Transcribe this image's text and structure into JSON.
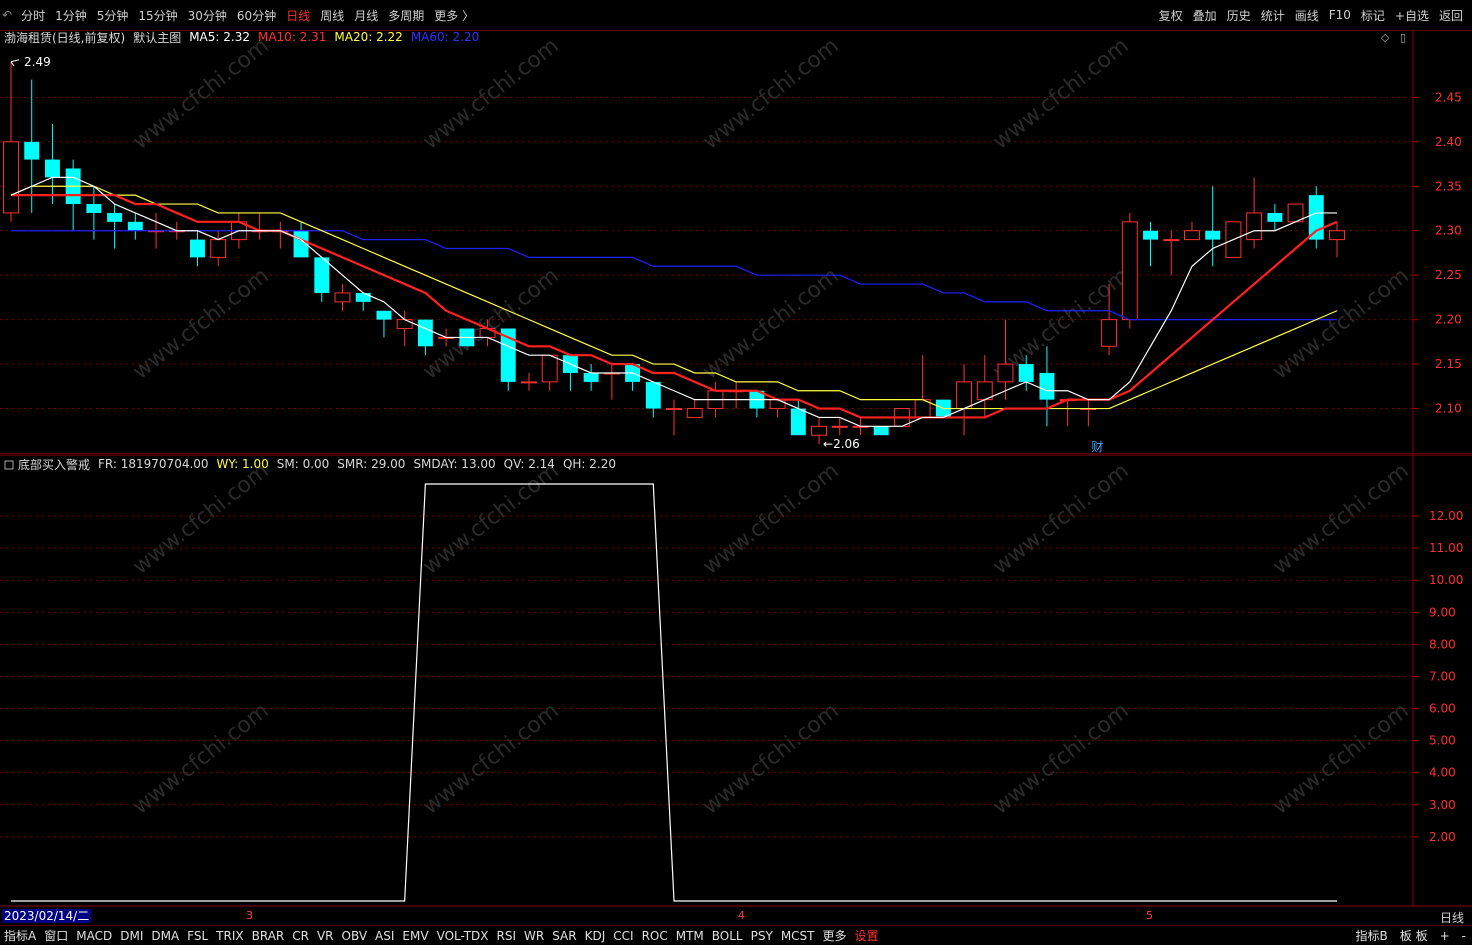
{
  "toolbar": {
    "periods": [
      "分时",
      "1分钟",
      "5分钟",
      "15分钟",
      "30分钟",
      "60分钟",
      "日线",
      "周线",
      "月线",
      "多周期",
      "更多 〉"
    ],
    "active_period": "日线",
    "right_buttons": [
      "复权",
      "叠加",
      "历史",
      "统计",
      "画线",
      "F10",
      "标记",
      "+自选",
      "返回"
    ]
  },
  "main_chart": {
    "stock_title": "渤海租赁(日线,前复权)",
    "template_label": "默认主图",
    "ma5": {
      "label": "MA5: 2.32",
      "color": "#ffffff"
    },
    "ma10": {
      "label": "MA10: 2.31",
      "color": "#ff2020"
    },
    "ma20": {
      "label": "MA20: 2.22",
      "color": "#ffff40"
    },
    "ma60": {
      "label": "MA60: 2.20",
      "color": "#2020ff"
    },
    "price_ticks": [
      "2.45",
      "2.40",
      "2.35",
      "2.30",
      "2.25",
      "2.20",
      "2.15",
      "2.10"
    ],
    "high_marker": "2.49",
    "low_marker": "←2.06",
    "finance_marker": "财"
  },
  "indicator_chart": {
    "name": "底部买入警戒",
    "fr": "FR: 181970704.00",
    "wy": "WY: 1.00",
    "sm": "SM: 0.00",
    "smr": "SMR: 29.00",
    "smday": "SMDAY: 13.00",
    "qv": "QV: 2.14",
    "qh": "QH: 2.20",
    "wy_color": "#ffff40",
    "ticks": [
      "12.00",
      "11.00",
      "10.00",
      "9.00",
      "8.00",
      "7.00",
      "6.00",
      "5.00",
      "4.00",
      "3.00",
      "2.00"
    ]
  },
  "chart_data": {
    "type": "candlestick",
    "up_color": "#ff3030",
    "down_color": "#00ffff",
    "ylim": [
      2.05,
      2.51
    ],
    "candles": [
      [
        2.32,
        2.4,
        2.31,
        2.49
      ],
      [
        2.4,
        2.38,
        2.32,
        2.47
      ],
      [
        2.38,
        2.36,
        2.33,
        2.42
      ],
      [
        2.37,
        2.33,
        2.3,
        2.38
      ],
      [
        2.33,
        2.32,
        2.29,
        2.35
      ],
      [
        2.32,
        2.31,
        2.28,
        2.33
      ],
      [
        2.31,
        2.3,
        2.29,
        2.32
      ],
      [
        2.3,
        2.3,
        2.28,
        2.32
      ],
      [
        2.3,
        2.3,
        2.29,
        2.31
      ],
      [
        2.29,
        2.27,
        2.26,
        2.3
      ],
      [
        2.27,
        2.29,
        2.26,
        2.3
      ],
      [
        2.29,
        2.31,
        2.28,
        2.32
      ],
      [
        2.3,
        2.3,
        2.29,
        2.32
      ],
      [
        2.3,
        2.3,
        2.28,
        2.31
      ],
      [
        2.3,
        2.27,
        2.27,
        2.31
      ],
      [
        2.27,
        2.23,
        2.22,
        2.27
      ],
      [
        2.22,
        2.23,
        2.21,
        2.24
      ],
      [
        2.23,
        2.22,
        2.21,
        2.23
      ],
      [
        2.21,
        2.2,
        2.18,
        2.21
      ],
      [
        2.19,
        2.2,
        2.17,
        2.21
      ],
      [
        2.2,
        2.17,
        2.16,
        2.2
      ],
      [
        2.18,
        2.18,
        2.17,
        2.19
      ],
      [
        2.19,
        2.17,
        2.17,
        2.19
      ],
      [
        2.18,
        2.19,
        2.17,
        2.2
      ],
      [
        2.19,
        2.13,
        2.12,
        2.19
      ],
      [
        2.13,
        2.13,
        2.12,
        2.14
      ],
      [
        2.13,
        2.16,
        2.12,
        2.16
      ],
      [
        2.16,
        2.14,
        2.12,
        2.16
      ],
      [
        2.14,
        2.13,
        2.12,
        2.15
      ],
      [
        2.14,
        2.14,
        2.11,
        2.15
      ],
      [
        2.15,
        2.13,
        2.12,
        2.15
      ],
      [
        2.13,
        2.1,
        2.09,
        2.13
      ],
      [
        2.1,
        2.1,
        2.07,
        2.11
      ],
      [
        2.09,
        2.1,
        2.09,
        2.11
      ],
      [
        2.1,
        2.12,
        2.09,
        2.13
      ],
      [
        2.12,
        2.12,
        2.1,
        2.13
      ],
      [
        2.12,
        2.1,
        2.09,
        2.12
      ],
      [
        2.1,
        2.11,
        2.09,
        2.11
      ],
      [
        2.1,
        2.07,
        2.07,
        2.11
      ],
      [
        2.07,
        2.08,
        2.06,
        2.09
      ],
      [
        2.08,
        2.08,
        2.07,
        2.09
      ],
      [
        2.08,
        2.08,
        2.07,
        2.09
      ],
      [
        2.08,
        2.07,
        2.07,
        2.08
      ],
      [
        2.08,
        2.1,
        2.08,
        2.1
      ],
      [
        2.09,
        2.11,
        2.09,
        2.16
      ],
      [
        2.11,
        2.09,
        2.09,
        2.11
      ],
      [
        2.1,
        2.13,
        2.07,
        2.15
      ],
      [
        2.11,
        2.13,
        2.09,
        2.16
      ],
      [
        2.13,
        2.15,
        2.11,
        2.2
      ],
      [
        2.15,
        2.13,
        2.12,
        2.16
      ],
      [
        2.14,
        2.11,
        2.08,
        2.17
      ],
      [
        2.11,
        2.11,
        2.08,
        2.11
      ],
      [
        2.1,
        2.1,
        2.08,
        2.11
      ],
      [
        2.17,
        2.2,
        2.16,
        2.24
      ],
      [
        2.2,
        2.31,
        2.19,
        2.32
      ],
      [
        2.3,
        2.29,
        2.26,
        2.31
      ],
      [
        2.29,
        2.29,
        2.25,
        2.3
      ],
      [
        2.29,
        2.3,
        2.29,
        2.31
      ],
      [
        2.3,
        2.29,
        2.26,
        2.35
      ],
      [
        2.27,
        2.31,
        2.27,
        2.31
      ],
      [
        2.29,
        2.32,
        2.28,
        2.36
      ],
      [
        2.32,
        2.31,
        2.3,
        2.33
      ],
      [
        2.31,
        2.33,
        2.31,
        2.33
      ],
      [
        2.34,
        2.29,
        2.28,
        2.35
      ],
      [
        2.29,
        2.3,
        2.27,
        2.31
      ]
    ],
    "ma5": [
      2.34,
      2.35,
      2.36,
      2.36,
      2.35,
      2.33,
      2.32,
      2.31,
      2.3,
      2.3,
      2.29,
      2.3,
      2.3,
      2.3,
      2.29,
      2.27,
      2.25,
      2.23,
      2.22,
      2.2,
      2.19,
      2.18,
      2.18,
      2.18,
      2.17,
      2.16,
      2.16,
      2.15,
      2.14,
      2.14,
      2.14,
      2.13,
      2.12,
      2.11,
      2.11,
      2.11,
      2.11,
      2.11,
      2.1,
      2.09,
      2.09,
      2.08,
      2.08,
      2.08,
      2.09,
      2.09,
      2.1,
      2.11,
      2.12,
      2.13,
      2.12,
      2.12,
      2.11,
      2.11,
      2.13,
      2.17,
      2.21,
      2.26,
      2.28,
      2.29,
      2.3,
      2.3,
      2.31,
      2.32,
      2.32
    ],
    "ma10": [
      2.34,
      2.34,
      2.34,
      2.34,
      2.34,
      2.34,
      2.33,
      2.33,
      2.32,
      2.31,
      2.31,
      2.31,
      2.3,
      2.3,
      2.29,
      2.28,
      2.27,
      2.26,
      2.25,
      2.24,
      2.23,
      2.21,
      2.2,
      2.19,
      2.18,
      2.17,
      2.17,
      2.16,
      2.16,
      2.15,
      2.15,
      2.14,
      2.14,
      2.13,
      2.12,
      2.12,
      2.12,
      2.11,
      2.11,
      2.1,
      2.1,
      2.09,
      2.09,
      2.09,
      2.09,
      2.09,
      2.09,
      2.09,
      2.1,
      2.1,
      2.1,
      2.11,
      2.11,
      2.11,
      2.12,
      2.14,
      2.16,
      2.18,
      2.2,
      2.22,
      2.24,
      2.26,
      2.28,
      2.3,
      2.31
    ],
    "ma20": [
      2.34,
      2.35,
      2.35,
      2.35,
      2.35,
      2.34,
      2.34,
      2.33,
      2.33,
      2.33,
      2.32,
      2.32,
      2.32,
      2.32,
      2.31,
      2.3,
      2.29,
      2.28,
      2.27,
      2.26,
      2.25,
      2.24,
      2.23,
      2.22,
      2.21,
      2.2,
      2.19,
      2.18,
      2.17,
      2.16,
      2.16,
      2.15,
      2.15,
      2.14,
      2.14,
      2.13,
      2.13,
      2.13,
      2.12,
      2.12,
      2.12,
      2.11,
      2.11,
      2.11,
      2.11,
      2.1,
      2.1,
      2.1,
      2.1,
      2.1,
      2.1,
      2.1,
      2.1,
      2.1,
      2.11,
      2.12,
      2.13,
      2.14,
      2.15,
      2.16,
      2.17,
      2.18,
      2.19,
      2.2,
      2.21
    ],
    "ma60": [
      2.3,
      2.3,
      2.3,
      2.3,
      2.3,
      2.3,
      2.3,
      2.3,
      2.3,
      2.3,
      2.3,
      2.3,
      2.3,
      2.3,
      2.3,
      2.3,
      2.3,
      2.29,
      2.29,
      2.29,
      2.29,
      2.28,
      2.28,
      2.28,
      2.28,
      2.27,
      2.27,
      2.27,
      2.27,
      2.27,
      2.27,
      2.26,
      2.26,
      2.26,
      2.26,
      2.26,
      2.25,
      2.25,
      2.25,
      2.25,
      2.25,
      2.24,
      2.24,
      2.24,
      2.24,
      2.23,
      2.23,
      2.22,
      2.22,
      2.22,
      2.21,
      2.21,
      2.21,
      2.21,
      2.2,
      2.2,
      2.2,
      2.2,
      2.2,
      2.2,
      2.2,
      2.2,
      2.2,
      2.2,
      2.2
    ],
    "indicator": {
      "type": "line",
      "ylim": [
        0,
        13
      ],
      "values": [
        0,
        0,
        0,
        0,
        0,
        0,
        0,
        0,
        0,
        0,
        0,
        0,
        0,
        0,
        0,
        0,
        0,
        0,
        0,
        0,
        13,
        13,
        13,
        13,
        13,
        13,
        13,
        13,
        13,
        13,
        13,
        13,
        0,
        0,
        0,
        0,
        0,
        0,
        0,
        0,
        0,
        0,
        0,
        0,
        0,
        0,
        0,
        0,
        0,
        0,
        0,
        0,
        0,
        0,
        0,
        0,
        0,
        0,
        0,
        0,
        0,
        0,
        0,
        0,
        0
      ]
    }
  },
  "date_axis": {
    "current_date": "2023/02/14/二",
    "months": [
      "3",
      "4",
      "5"
    ],
    "period": "日线"
  },
  "bottombar": {
    "tabs": [
      "指标A",
      "窗口",
      "MACD",
      "DMI",
      "DMA",
      "FSL",
      "TRIX",
      "BRAR",
      "CR",
      "VR",
      "OBV",
      "ASI",
      "EMV",
      "VOL-TDX",
      "RSI",
      "WR",
      "SAR",
      "KDJ",
      "CCI",
      "ROC",
      "MTM",
      "BOLL",
      "PSY",
      "MCST",
      "更多",
      "设置"
    ],
    "right": [
      "指标B",
      "板 板",
      "+",
      "-"
    ]
  },
  "watermark": "www.cfchi.com"
}
